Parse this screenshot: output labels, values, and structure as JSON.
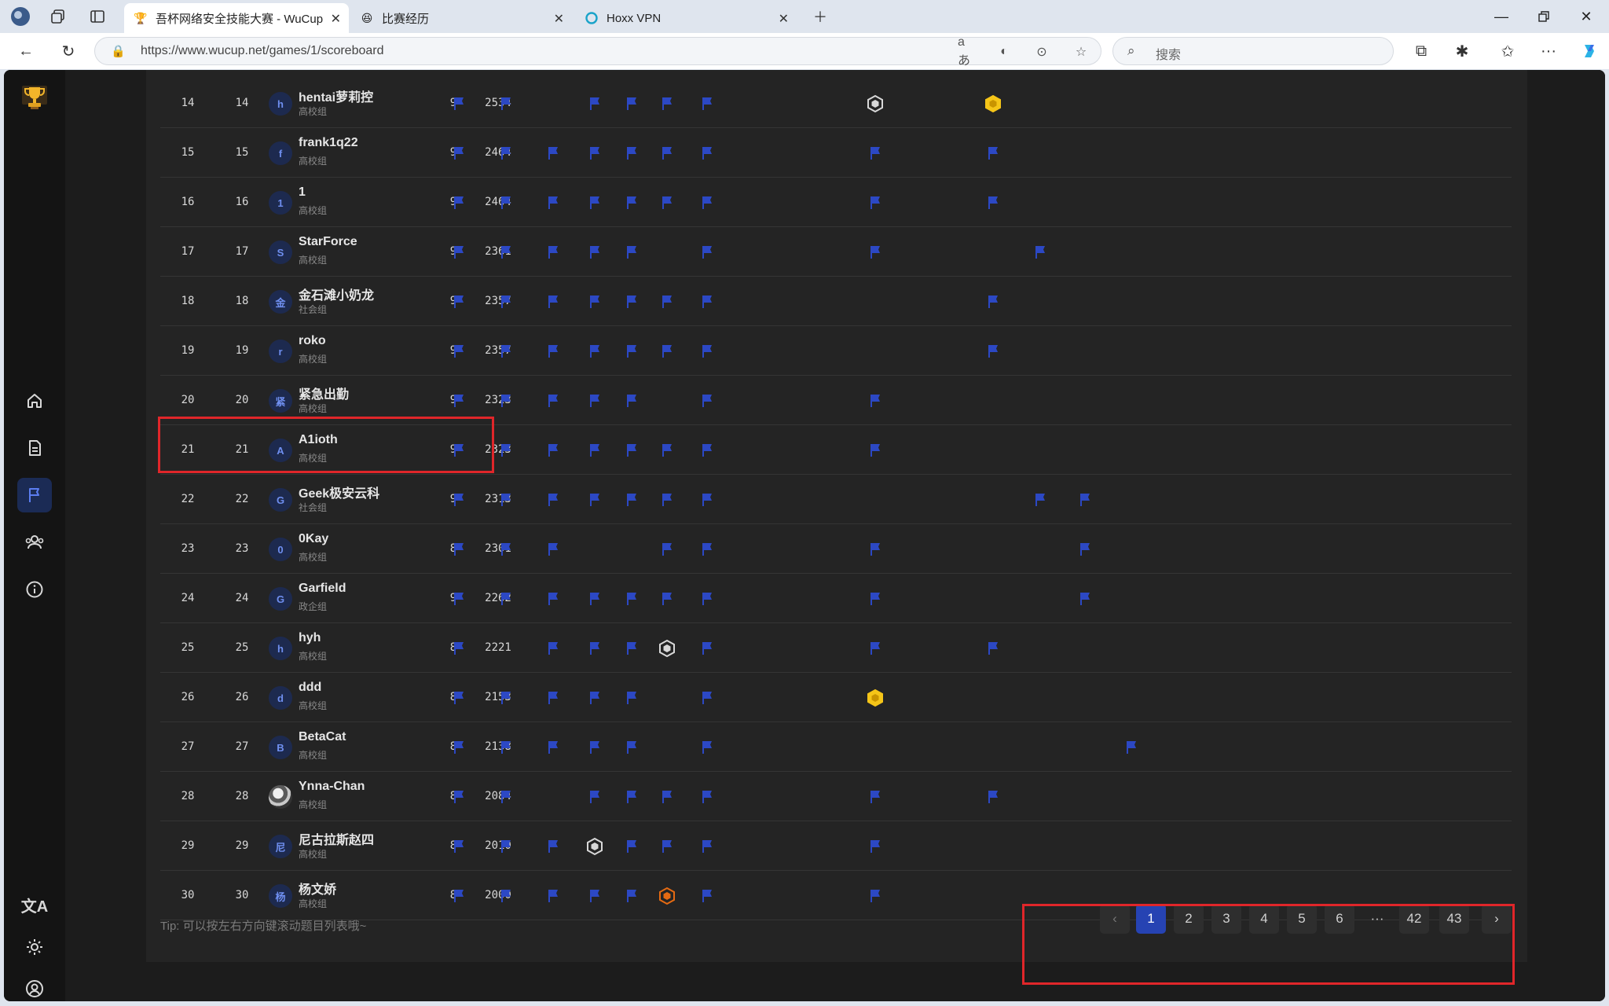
{
  "browser": {
    "tabs": [
      {
        "title": "吾杯网络安全技能大赛 - WuCup",
        "active": true
      },
      {
        "title": "比赛经历",
        "active": false
      },
      {
        "title": "Hoxx VPN",
        "active": false
      }
    ],
    "url": "https://www.wucup.net/games/1/scoreboard",
    "search_placeholder": "搜索"
  },
  "sidebar": {
    "items": [
      "home-icon",
      "document-icon",
      "flag-icon",
      "users-icon",
      "info-icon"
    ],
    "active": "flag-icon",
    "bottom": [
      "translate-icon",
      "theme-icon",
      "account-icon"
    ]
  },
  "colors": {
    "flag": "#2c48c4",
    "accent": "#2643b3",
    "highlight": "#e0262a",
    "gold": "#f5c518",
    "orange": "#e46a12"
  },
  "scoreboard": {
    "rows": [
      {
        "rank": "14",
        "pos": "14",
        "avatar": "h",
        "name": "hentai萝莉控",
        "group": "高校组",
        "solved": "9",
        "score": "2534"
      },
      {
        "rank": "15",
        "pos": "15",
        "avatar": "f",
        "name": "frank1q22",
        "group": "高校组",
        "solved": "9",
        "score": "2464"
      },
      {
        "rank": "16",
        "pos": "16",
        "avatar": "1",
        "name": "1",
        "group": "高校组",
        "solved": "9",
        "score": "2464"
      },
      {
        "rank": "17",
        "pos": "17",
        "avatar": "S",
        "name": "StarForce",
        "group": "高校组",
        "solved": "9",
        "score": "2361"
      },
      {
        "rank": "18",
        "pos": "18",
        "avatar": "金",
        "name": "金石滩小奶龙",
        "group": "社会组",
        "solved": "9",
        "score": "2357"
      },
      {
        "rank": "19",
        "pos": "19",
        "avatar": "r",
        "name": "roko",
        "group": "高校组",
        "solved": "9",
        "score": "2357"
      },
      {
        "rank": "20",
        "pos": "20",
        "avatar": "紧",
        "name": "紧急出勤",
        "group": "高校组",
        "solved": "9",
        "score": "2323"
      },
      {
        "rank": "21",
        "pos": "21",
        "avatar": "A",
        "name": "A1ioth",
        "group": "高校组",
        "solved": "9",
        "score": "2323"
      },
      {
        "rank": "22",
        "pos": "22",
        "avatar": "G",
        "name": "Geek极安云科",
        "group": "社会组",
        "solved": "9",
        "score": "2313"
      },
      {
        "rank": "23",
        "pos": "23",
        "avatar": "0",
        "name": "0Kay",
        "group": "高校组",
        "solved": "8",
        "score": "2301"
      },
      {
        "rank": "24",
        "pos": "24",
        "avatar": "G",
        "name": "Garfield",
        "group": "政企组",
        "solved": "9",
        "score": "2262"
      },
      {
        "rank": "25",
        "pos": "25",
        "avatar": "h",
        "name": "hyh",
        "group": "高校组",
        "solved": "8",
        "score": "2221"
      },
      {
        "rank": "26",
        "pos": "26",
        "avatar": "d",
        "name": "ddd",
        "group": "高校组",
        "solved": "8",
        "score": "2153"
      },
      {
        "rank": "27",
        "pos": "27",
        "avatar": "B",
        "name": "BetaCat",
        "group": "高校组",
        "solved": "8",
        "score": "2138"
      },
      {
        "rank": "28",
        "pos": "28",
        "avatar": "",
        "name": "Ynna-Chan",
        "group": "高校组",
        "solved": "8",
        "score": "2084"
      },
      {
        "rank": "29",
        "pos": "29",
        "avatar": "尼",
        "name": "尼古拉斯赵四",
        "group": "高校组",
        "solved": "8",
        "score": "2010"
      },
      {
        "rank": "30",
        "pos": "30",
        "avatar": "杨",
        "name": "杨文娇",
        "group": "高校组",
        "solved": "8",
        "score": "2000"
      }
    ],
    "marks": [
      {
        "f": [
          0,
          1,
          3,
          4,
          5,
          6
        ],
        "o": {
          "7": "silver",
          "8": "gold"
        }
      },
      {
        "f": [
          0,
          1,
          2,
          3,
          4,
          5,
          6,
          7,
          8
        ],
        "o": {}
      },
      {
        "f": [
          0,
          1,
          2,
          3,
          4,
          5,
          6,
          7,
          8
        ],
        "o": {}
      },
      {
        "f": [
          0,
          1,
          2,
          3,
          4,
          6,
          7,
          9
        ],
        "o": {}
      },
      {
        "f": [
          0,
          1,
          2,
          3,
          4,
          5,
          6,
          8
        ],
        "o": {}
      },
      {
        "f": [
          0,
          1,
          2,
          3,
          4,
          5,
          6,
          8
        ],
        "o": {}
      },
      {
        "f": [
          0,
          1,
          2,
          3,
          4,
          6,
          7
        ],
        "o": {}
      },
      {
        "f": [
          0,
          1,
          2,
          3,
          4,
          5,
          6,
          7
        ],
        "o": {}
      },
      {
        "f": [
          0,
          1,
          2,
          3,
          4,
          5,
          6,
          9,
          10
        ],
        "o": {}
      },
      {
        "f": [
          0,
          1,
          2,
          5,
          6,
          7,
          10
        ],
        "o": {}
      },
      {
        "f": [
          0,
          1,
          2,
          3,
          4,
          5,
          6,
          7,
          10
        ],
        "o": {}
      },
      {
        "f": [
          0,
          2,
          3,
          4,
          6,
          7,
          8
        ],
        "o": {
          "5": "silver"
        }
      },
      {
        "f": [
          0,
          1,
          2,
          3,
          4,
          6
        ],
        "o": {
          "7": "gold"
        }
      },
      {
        "f": [
          0,
          1,
          2,
          3,
          11,
          4,
          6
        ],
        "o": {}
      },
      {
        "f": [
          0,
          1,
          3,
          4,
          5,
          6,
          7,
          8
        ],
        "o": {}
      },
      {
        "f": [
          0,
          1,
          2,
          4,
          5,
          6,
          7
        ],
        "o": {
          "3": "silver"
        }
      },
      {
        "f": [
          0,
          1,
          2,
          3,
          4,
          6,
          7
        ],
        "o": {
          "5": "orange"
        }
      }
    ],
    "tip": "Tip: 可以按左右方向键滚动题目列表哦~"
  },
  "pagination": {
    "prev": "‹",
    "next": "›",
    "pages": [
      "1",
      "2",
      "3",
      "4",
      "5",
      "6",
      "···",
      "42",
      "43"
    ],
    "current": "1"
  }
}
